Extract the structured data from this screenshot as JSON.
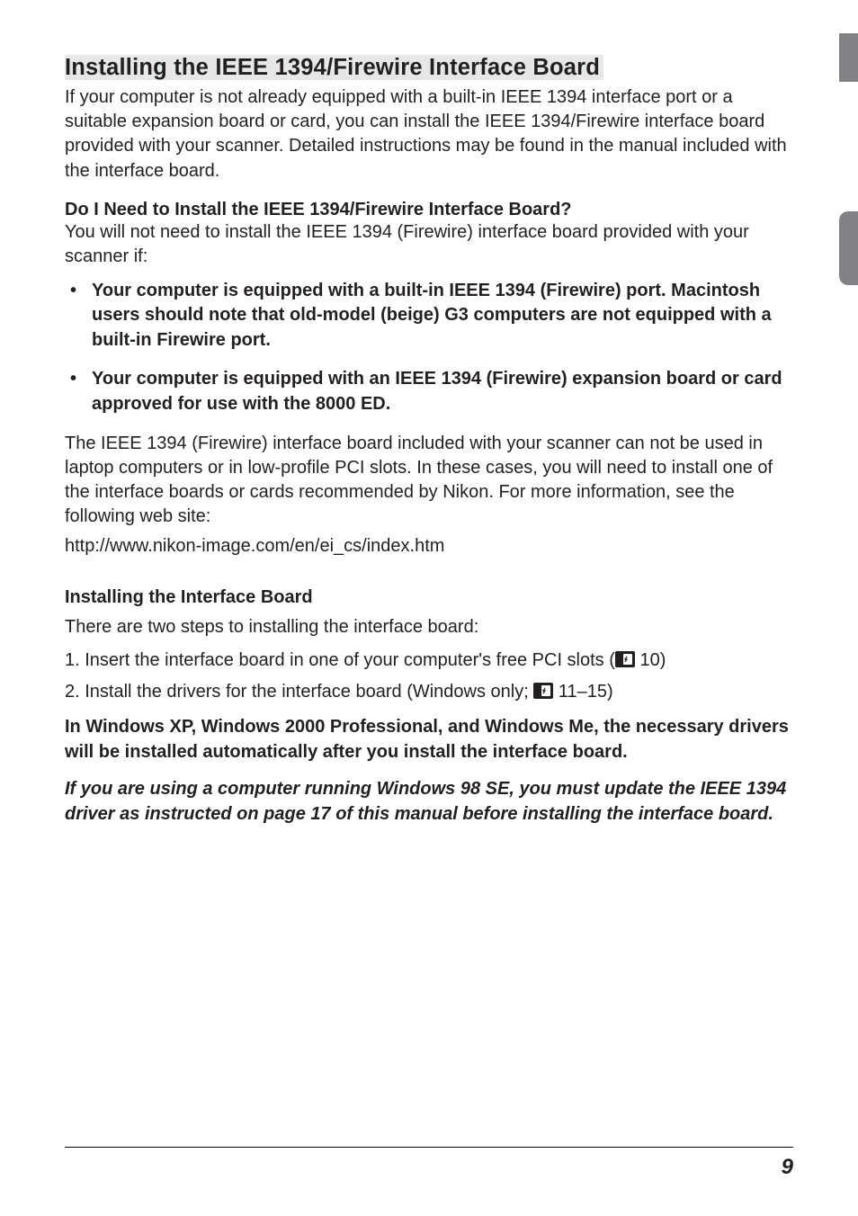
{
  "heading": "Installing the IEEE 1394/Firewire Interface Board",
  "intro": "If your computer is not already equipped with a built-in IEEE 1394 interface port or a suitable expansion board or card, you can install the IEEE 1394/Firewire interface board provided with your scanner.  Detailed instructions may be found in the manual included with the interface board.",
  "subhead1": "Do I Need to Install the IEEE 1394/Firewire Interface Board?",
  "lead1": "You will not need to install the IEEE 1394 (Firewire) interface board provided with your scanner if:",
  "bullets": [
    "Your computer is equipped with a built-in IEEE 1394 (Firewire) port.  Macintosh users should note that old-model (beige) G3 computers are not equipped with a built-in Firewire port.",
    "Your computer is equipped with an IEEE 1394 (Firewire) expansion board or card approved for use with the 8000 ED."
  ],
  "para2": "The IEEE 1394 (Firewire) interface board included with your scanner can not be used in laptop computers or in low-profile PCI slots.  In these cases, you will need to install one of the interface boards or cards recommended by Nikon.  For more information, see the following web site:",
  "url": "http://www.nikon-image.com/en/ei_cs/index.htm",
  "subhead2": "Installing the Interface Board",
  "steps_intro": "There are two steps to installing the interface board:",
  "step1_pre": "1.  Insert the interface board in one of your computer's free PCI slots (",
  "step1_ref": " 10)",
  "step2_pre": "2.  Install the drivers for the interface board (Windows only; ",
  "step2_ref": " 11–15)",
  "win_note": "In Windows XP, Windows 2000 Professional, and Windows Me, the necessary drivers will be installed automatically after you install the interface board.",
  "italic_note": "If you are using a computer running Windows 98 SE, you must update the IEEE 1394 driver as instructed on page 17 of this manual before installing the interface board.",
  "page_number": "9"
}
